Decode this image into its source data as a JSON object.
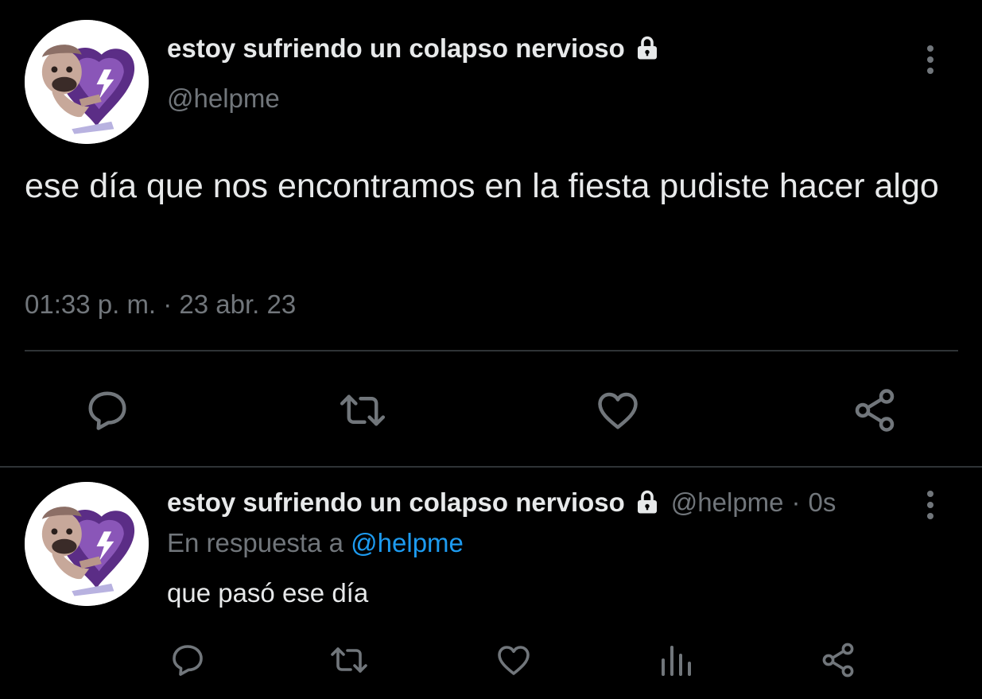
{
  "main_tweet": {
    "display_name": "estoy sufriendo un colapso nervioso",
    "handle": "@helpme",
    "text": "ese día que nos encontramos en la fiesta pudiste hacer algo",
    "timestamp": "01:33 p. m. · 23 abr. 23",
    "icons": {
      "avatar": "avatar-image",
      "lock": "lock-icon",
      "more": "more-vertical-icon",
      "reply": "reply-icon",
      "retweet": "retweet-icon",
      "like": "heart-icon",
      "share": "share-icon"
    }
  },
  "reply_tweet": {
    "display_name": "estoy sufriendo un colapso nervioso",
    "handle": "@helpme",
    "separator": "·",
    "time": "0s",
    "replying_to_prefix": "En respuesta a",
    "replying_to_handle": "@helpme",
    "text": "que pasó ese día",
    "icons": {
      "reply": "reply-icon",
      "retweet": "retweet-icon",
      "like": "heart-icon",
      "views": "views-icon",
      "share": "share-icon"
    }
  },
  "colors": {
    "background": "#000000",
    "text_primary": "#e7e9ea",
    "text_secondary": "#71767b",
    "link": "#1d9bf0",
    "divider": "#2f3336",
    "icon": "#71767b"
  }
}
